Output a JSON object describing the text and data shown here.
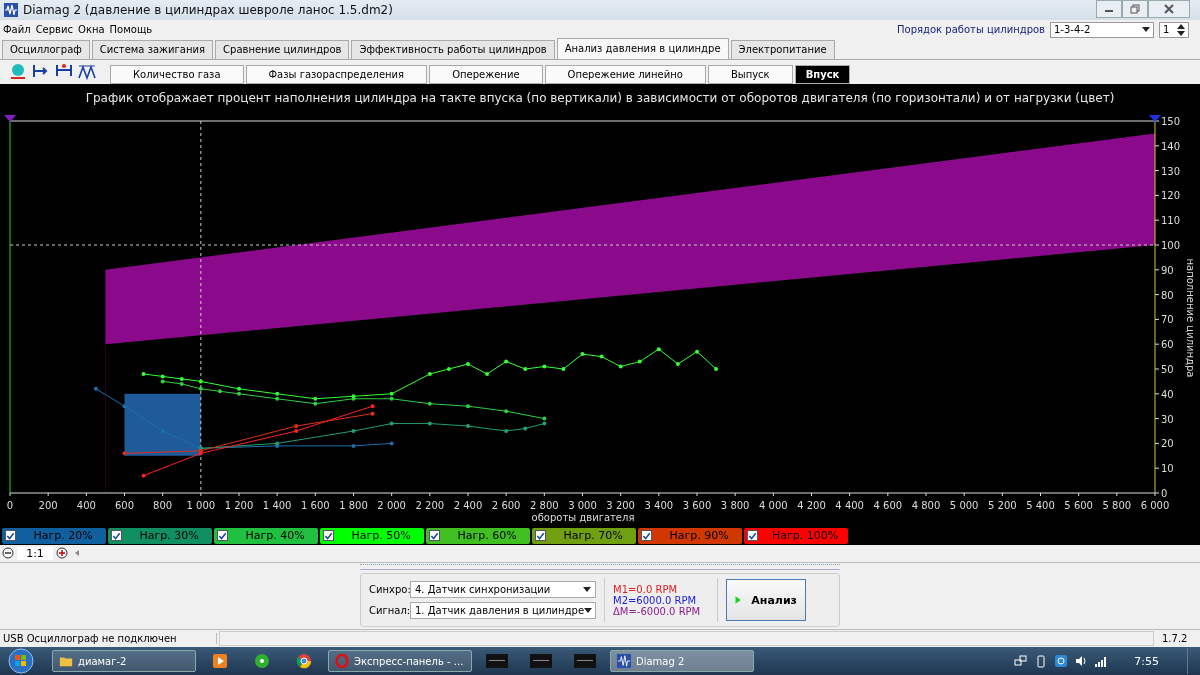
{
  "window": {
    "title": "Diamag 2 (давление в цилиндрах шевроле ланос 1.5.dm2)"
  },
  "menu": [
    "Файл",
    "Сервис",
    "Окна",
    "Помощь"
  ],
  "firing_order": {
    "label": "Порядок работы цилиндров",
    "value": "1-3-4-2",
    "cylinder": "1"
  },
  "tabs": [
    {
      "label": "Осциллограф",
      "selected": false
    },
    {
      "label": "Система зажигания",
      "selected": false
    },
    {
      "label": "Сравнение цилиндров",
      "selected": false
    },
    {
      "label": "Эффективность работы цилиндров",
      "selected": false
    },
    {
      "label": "Анализ давления в цилиндре",
      "selected": true
    },
    {
      "label": "Электропитание",
      "selected": false
    }
  ],
  "subtabs": [
    {
      "label": "Количество газа",
      "selected": false
    },
    {
      "label": "Фазы газораспределения",
      "selected": false
    },
    {
      "label": "Опережение",
      "selected": false
    },
    {
      "label": "Опережение линейно",
      "selected": false
    },
    {
      "label": "Выпуск",
      "selected": false
    },
    {
      "label": "Впуск",
      "selected": true
    }
  ],
  "chart": {
    "chart_data": {
      "type": "line",
      "title": "График отображает процент наполнения цилиндра на такте впуска (по вертикали) в зависимости от оборотов двигателя (по горизонтали) и от нагрузки (цвет)",
      "xlabel": "обороты двигателя",
      "ylabel": "наполнение цилиндра",
      "xlim": [
        0,
        6000
      ],
      "ylim": [
        0,
        150
      ],
      "xticks": [
        {
          "value": 0,
          "label": "0"
        },
        {
          "value": 200,
          "label": "200"
        },
        {
          "value": 400,
          "label": "400"
        },
        {
          "value": 600,
          "label": "600"
        },
        {
          "value": 800,
          "label": "800"
        },
        {
          "value": 1000,
          "label": "1 000"
        },
        {
          "value": 1200,
          "label": "1 200"
        },
        {
          "value": 1400,
          "label": "1 400"
        },
        {
          "value": 1600,
          "label": "1 600"
        },
        {
          "value": 1800,
          "label": "1 800"
        },
        {
          "value": 2000,
          "label": "2 000"
        },
        {
          "value": 2200,
          "label": "2 200"
        },
        {
          "value": 2400,
          "label": "2 400"
        },
        {
          "value": 2600,
          "label": "2 600"
        },
        {
          "value": 2800,
          "label": "2 800"
        },
        {
          "value": 3000,
          "label": "3 000"
        },
        {
          "value": 3200,
          "label": "3 200"
        },
        {
          "value": 3400,
          "label": "3 400"
        },
        {
          "value": 3600,
          "label": "3 600"
        },
        {
          "value": 3800,
          "label": "3 800"
        },
        {
          "value": 4000,
          "label": "4 000"
        },
        {
          "value": 4200,
          "label": "4 200"
        },
        {
          "value": 4400,
          "label": "4 400"
        },
        {
          "value": 4600,
          "label": "4 600"
        },
        {
          "value": 4800,
          "label": "4 800"
        },
        {
          "value": 5000,
          "label": "5 000"
        },
        {
          "value": 5200,
          "label": "5 200"
        },
        {
          "value": 5400,
          "label": "5 400"
        },
        {
          "value": 5600,
          "label": "5 600"
        },
        {
          "value": 5800,
          "label": "5 800"
        },
        {
          "value": 6000,
          "label": "6 000"
        }
      ],
      "yticks": [
        0,
        10,
        20,
        30,
        40,
        50,
        60,
        70,
        80,
        90,
        100,
        110,
        120,
        130,
        140,
        150
      ],
      "series": [
        {
          "type": "area",
          "color": "#8b0a8b",
          "x": [
            500,
            6000
          ],
          "values": [
            90,
            145
          ]
        },
        {
          "type": "area",
          "color": "#000000",
          "x": [
            500,
            6000
          ],
          "values": [
            60,
            100
          ]
        },
        {
          "color": "#1a6fb0",
          "x": [
            450,
            600,
            800,
            1000,
            1400,
            1800,
            2000
          ],
          "values": [
            42,
            35,
            25,
            18,
            19,
            19,
            20
          ]
        },
        {
          "color": "#20a070",
          "x": [
            1000,
            1400,
            1800,
            2000,
            2200,
            2400,
            2600,
            2700,
            2800
          ],
          "values": [
            18,
            20,
            25,
            28,
            28,
            27,
            25,
            26,
            28
          ]
        },
        {
          "color": "#30d040",
          "x": [
            800,
            900,
            1000,
            1100,
            1200,
            1400,
            1600,
            1800,
            2000,
            2200,
            2400,
            2600,
            2800
          ],
          "values": [
            45,
            44,
            42,
            41,
            40,
            38,
            36,
            38,
            38,
            36,
            35,
            33,
            30
          ]
        },
        {
          "color": "#33ff33",
          "x": [
            700,
            800,
            900,
            1000,
            1200,
            1400,
            1600,
            1800,
            2000,
            2200,
            2300,
            2400,
            2500,
            2600,
            2700,
            2800,
            2900,
            3000,
            3100,
            3200,
            3300,
            3400,
            3500,
            3600,
            3700
          ],
          "values": [
            48,
            47,
            46,
            45,
            42,
            40,
            38,
            39,
            40,
            48,
            50,
            52,
            48,
            53,
            50,
            51,
            50,
            56,
            55,
            51,
            53,
            58,
            52,
            57,
            50
          ]
        },
        {
          "color": "#e03010",
          "x": [
            600,
            1000,
            1500,
            1900
          ],
          "values": [
            16,
            17,
            27,
            32
          ]
        },
        {
          "color": "#ff2020",
          "x": [
            700,
            1000,
            1500,
            1900
          ],
          "values": [
            7,
            16,
            25,
            35
          ]
        }
      ],
      "ref_lines": [
        {
          "axis": "x",
          "value": 1000
        },
        {
          "axis": "y",
          "value": 100
        }
      ]
    }
  },
  "legend": [
    {
      "label": "Нагр. 20%",
      "color": "#1060a0",
      "checked": true
    },
    {
      "label": "Нагр. 30%",
      "color": "#109060",
      "checked": true
    },
    {
      "label": "Нагр. 40%",
      "color": "#20c040",
      "checked": true
    },
    {
      "label": "Нагр. 50%",
      "color": "#00ff00",
      "checked": true
    },
    {
      "label": "Нагр. 60%",
      "color": "#40c020",
      "checked": true
    },
    {
      "label": "Нагр. 70%",
      "color": "#70a010",
      "checked": true
    },
    {
      "label": "Нагр. 90%",
      "color": "#d03800",
      "checked": true
    },
    {
      "label": "Нагр. 100%",
      "color": "#ff0000",
      "checked": true
    }
  ],
  "zoom": "1:1",
  "analysis": {
    "sync_label": "Синхро:",
    "sync_value": "4.  Датчик синхронизации",
    "signal_label": "Сигнал:",
    "signal_value": "1.  Датчик давления в цилиндре",
    "m1": "M1=0.0 RPM",
    "m2": "M2=6000.0 RPM",
    "dm": "ΔM=-6000.0 RPM",
    "button": "Анализ"
  },
  "status_bar": {
    "text": "USB Осциллограф не подключен",
    "version": "1.7.2"
  },
  "taskbar": {
    "buttons": [
      {
        "label": "диамаг-2",
        "kind": "folder",
        "selected": false
      },
      {
        "label": "Экспресс-панель - ...",
        "kind": "browser",
        "selected": false
      },
      {
        "label": "Diamag 2",
        "kind": "app",
        "selected": true
      }
    ],
    "clock": "7:55"
  }
}
